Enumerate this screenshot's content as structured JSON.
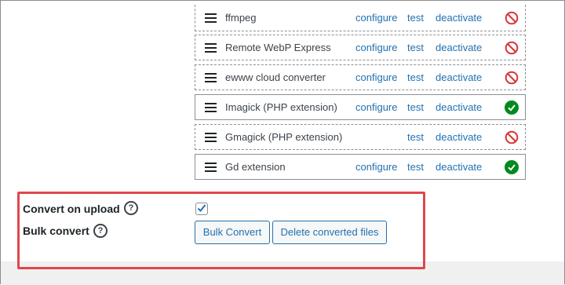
{
  "converters": [
    {
      "name": "ffmpeg",
      "configure": "configure",
      "test": "test",
      "deactivate": "deactivate",
      "status": "error",
      "status_icon": "prohibited-icon"
    },
    {
      "name": "Remote WebP Express",
      "configure": "configure",
      "test": "test",
      "deactivate": "deactivate",
      "status": "error",
      "status_icon": "prohibited-icon"
    },
    {
      "name": "ewww cloud converter",
      "configure": "configure",
      "test": "test",
      "deactivate": "deactivate",
      "status": "error",
      "status_icon": "prohibited-icon"
    },
    {
      "name": "Imagick (PHP extension)",
      "configure": "configure",
      "test": "test",
      "deactivate": "deactivate",
      "status": "ok",
      "status_icon": "check-circle-icon"
    },
    {
      "name": "Gmagick (PHP extension)",
      "configure": "",
      "test": "test",
      "deactivate": "deactivate",
      "status": "error",
      "status_icon": "prohibited-icon"
    },
    {
      "name": "Gd extension",
      "configure": "configure",
      "test": "test",
      "deactivate": "deactivate",
      "status": "ok",
      "status_icon": "check-circle-icon"
    }
  ],
  "options": {
    "convert_on_upload": {
      "label": "Convert on upload",
      "help": "?",
      "checked": true
    },
    "bulk_convert": {
      "label": "Bulk convert",
      "help": "?"
    }
  },
  "buttons": {
    "bulk_convert": "Bulk Convert",
    "delete_converted": "Delete converted files"
  },
  "colors": {
    "link": "#2271b1",
    "error": "#d63638",
    "ok": "#008a20",
    "highlight": "#e0474c"
  }
}
